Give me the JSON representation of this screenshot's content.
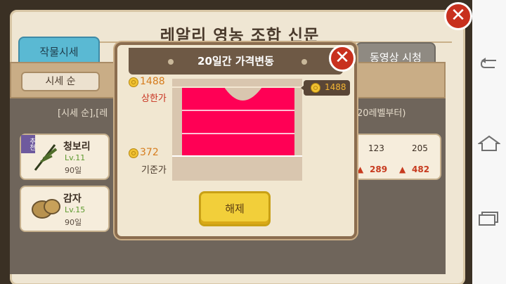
{
  "game": {
    "title": "레알리 영농 조합 신문",
    "tabs": {
      "active": "작물시세",
      "video": "동영상 시청"
    },
    "sort_button": "시세 순",
    "list_hint_left": "[시세 순],[레",
    "list_hint_right": "20레벨부터)",
    "items": [
      {
        "badge": "추천",
        "name": "청보리",
        "level": "Lv.11",
        "days": "90일"
      },
      {
        "name": "감자",
        "level": "Lv.15",
        "days": "90일"
      }
    ],
    "right_row": {
      "v1": "123",
      "v2": "205",
      "up1": "289",
      "up2": "482"
    }
  },
  "modal": {
    "title": "20일간 가격변동",
    "max_value": "1488",
    "max_label": "상한가",
    "min_value": "372",
    "min_label": "기준가",
    "current_tag": "1488",
    "release_button": "해제"
  },
  "chart_data": {
    "type": "area",
    "title": "20일간 가격변동",
    "ylim": [
      372,
      1488
    ],
    "labels": {
      "max": "상한가",
      "base": "기준가"
    },
    "current": 1488,
    "color": "#ff0055"
  },
  "colors": {
    "accent_pink": "#ff0055",
    "coin_gold": "#f1c232",
    "close_red": "#c8301e"
  }
}
